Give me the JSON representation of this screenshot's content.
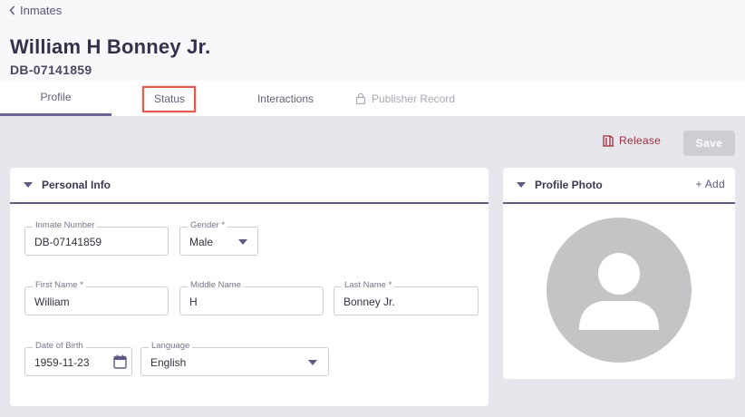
{
  "breadcrumb": {
    "label": "Inmates"
  },
  "page": {
    "title": "William H Bonney Jr.",
    "subtitle": "DB-07141859"
  },
  "tabs": [
    {
      "label": "Profile",
      "active": true
    },
    {
      "label": "Status",
      "active": false,
      "highlighted": true
    },
    {
      "label": "Interactions",
      "active": false
    },
    {
      "label": "Publisher Record",
      "active": false,
      "locked": true
    }
  ],
  "toolbar": {
    "release_label": "Release",
    "save_label": "Save",
    "release_icon": "door-exit-icon"
  },
  "personal_info": {
    "title": "Personal Info",
    "inmate_number": {
      "label": "Inmate Number",
      "value": "DB-07141859"
    },
    "gender": {
      "label": "Gender *",
      "value": "Male"
    },
    "first_name": {
      "label": "First Name *",
      "value": "William"
    },
    "middle_name": {
      "label": "Middle Name",
      "value": "H"
    },
    "last_name": {
      "label": "Last Name *",
      "value": "Bonney Jr."
    },
    "date_of_birth": {
      "label": "Date of Birth",
      "value": "1959-11-23"
    },
    "language": {
      "label": "Language",
      "value": "English"
    }
  },
  "profile_photo": {
    "title": "Profile Photo",
    "add_label": "+ Add",
    "avatar_icon": "default-avatar-icon"
  },
  "colors": {
    "accent": "#6b6596",
    "release": "#a02c3c",
    "highlight": "#e35b4e",
    "save_disabled": "#cfced5",
    "background": "#e7e6ec"
  }
}
